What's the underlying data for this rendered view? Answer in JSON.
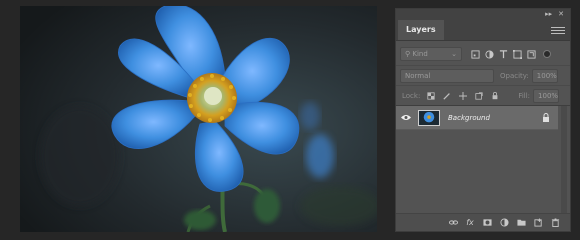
{
  "canvas": {
    "image_subject": "flower-photo"
  },
  "panel": {
    "topbar": {
      "collapse_glyph": "▸▸",
      "close_glyph": "✕"
    },
    "tab_label": "Layers",
    "kind_filter": {
      "placeholder": "Kind"
    },
    "blend_mode": "Normal",
    "opacity_label": "Opacity:",
    "opacity_value": "100%",
    "lock_label": "Lock:",
    "fill_label": "Fill:",
    "fill_value": "100%",
    "layers": [
      {
        "name": "Background",
        "visible": true,
        "locked": true
      }
    ],
    "footer": {
      "fx_label": "fx"
    }
  },
  "colors": {
    "panel_bg": "#535353",
    "selected_layer": "#6a6a6a",
    "petal": "#3f8fe0",
    "flower_center": "#d4a020"
  }
}
